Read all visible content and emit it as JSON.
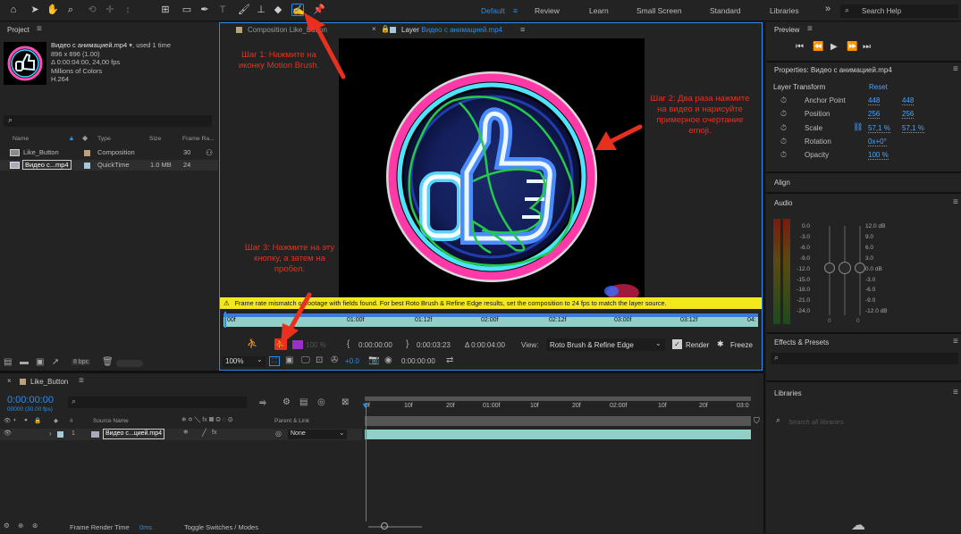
{
  "toolbar": {
    "workspaces": [
      "Default",
      "Review",
      "Learn",
      "Small Screen",
      "Standard",
      "Libraries"
    ],
    "active_workspace": "Default",
    "search_placeholder": "Search Help",
    "more": "»"
  },
  "project": {
    "title": "Project",
    "item_name": "Видео с анимацией.mp4",
    "used": ", used 1 time",
    "dims": "896 x 896 (1.00)",
    "duration": "Δ 0:00:04:00, 24,00 fps",
    "colors": "Millions of Colors",
    "codec": "H.264",
    "columns": [
      "Name",
      "Type",
      "Size",
      "Frame Ra..."
    ],
    "rows": [
      {
        "name": "Like_Button",
        "type": "Composition",
        "size": "",
        "fps": "30",
        "color": "#b9a37e"
      },
      {
        "name": "Видео с...mp4",
        "type": "QuickTime",
        "size": "1.0 MB",
        "fps": "24",
        "color": "#a7c9d8"
      }
    ],
    "bpc": "8 bpc"
  },
  "viewer": {
    "tab_comp": "Composition Like_Button",
    "tab_layer_prefix": "Layer",
    "tab_layer_name": "Видео с анимацией.mp4",
    "warning": "Frame rate mismatch or footage with fields found. For best Roto Brush & Refine Edge results, set the composition to 24 fps to match the layer source.",
    "ruler": [
      "00f",
      "01:00f",
      "01:12f",
      "02:00f",
      "02:12f",
      "03:00f",
      "03:12f",
      "04:"
    ],
    "zoom_pct": "100 %",
    "time_in": "0:00:00:00",
    "time_out": "0:00:03:23",
    "time_dur": "Δ 0:00:04:00",
    "view_label": "View:",
    "view_value": "Roto Brush & Refine Edge",
    "render_label": "Render",
    "freeze_label": "Freeze",
    "zoom": "100%",
    "exposure": "+0.0",
    "time_cur": "0:00:00:00"
  },
  "annotations": {
    "step1": "Шаг 1: Нажмите на иконку Motion Brush.",
    "step2": "Шаг 2: Два раза нажмите на видео и нарисуйте примерное очертание emoji.",
    "step3": "Шаг 3: Нажмите на эту кнопку, а затем на пробел."
  },
  "timeline": {
    "comp_name": "Like_Button",
    "timecode": "0:00:00:00",
    "frames": "00000 (30.00 fps)",
    "ruler": [
      "0f",
      "10f",
      "20f",
      "01:00f",
      "10f",
      "20f",
      "02:00f",
      "10f",
      "20f",
      "03:0"
    ],
    "col_source": "Source Name",
    "col_parent": "Parent & Link",
    "layer_num": "1",
    "layer_name": "Видео с...цией.mp4",
    "parent_value": "None",
    "footer_render": "Frame Render Time",
    "footer_render_value": "0ms",
    "footer_toggle": "Toggle Switches / Modes"
  },
  "preview": {
    "title": "Preview"
  },
  "properties": {
    "title": "Properties: Видео с анимацией.mp4",
    "section": "Layer Transform",
    "reset": "Reset",
    "props": [
      {
        "name": "Anchor Point",
        "v1": "448",
        "v2": "448"
      },
      {
        "name": "Position",
        "v1": "256",
        "v2": "256"
      },
      {
        "name": "Scale",
        "v1": "57,1 %",
        "v2": "57,1 %"
      },
      {
        "name": "Rotation",
        "v1": "0x+0°",
        "v2": ""
      },
      {
        "name": "Opacity",
        "v1": "100 %",
        "v2": ""
      }
    ]
  },
  "align": {
    "title": "Align"
  },
  "audio": {
    "title": "Audio",
    "left_scale": [
      "0.0",
      "-3.0",
      "-6.0",
      "-9.0",
      "-12.0",
      "-15.0",
      "-18.0",
      "-21.0",
      "-24.0"
    ],
    "right_scale": [
      "12.0 dB",
      "9.0",
      "6.0",
      "3.0",
      "0.0 dB",
      "-3.0",
      "-6.0",
      "-9.0",
      "-12.0 dB"
    ],
    "zero_left": "0",
    "zero_right": "0"
  },
  "effects": {
    "title": "Effects & Presets"
  },
  "libraries": {
    "title": "Libraries",
    "search_placeholder": "Search all libraries"
  },
  "colors": {
    "accent": "#2d8ceb",
    "annotation": "#e8301e",
    "warning": "#f3e81c",
    "bar": "#8fd1c9",
    "green_stroke": "#23c94a"
  }
}
